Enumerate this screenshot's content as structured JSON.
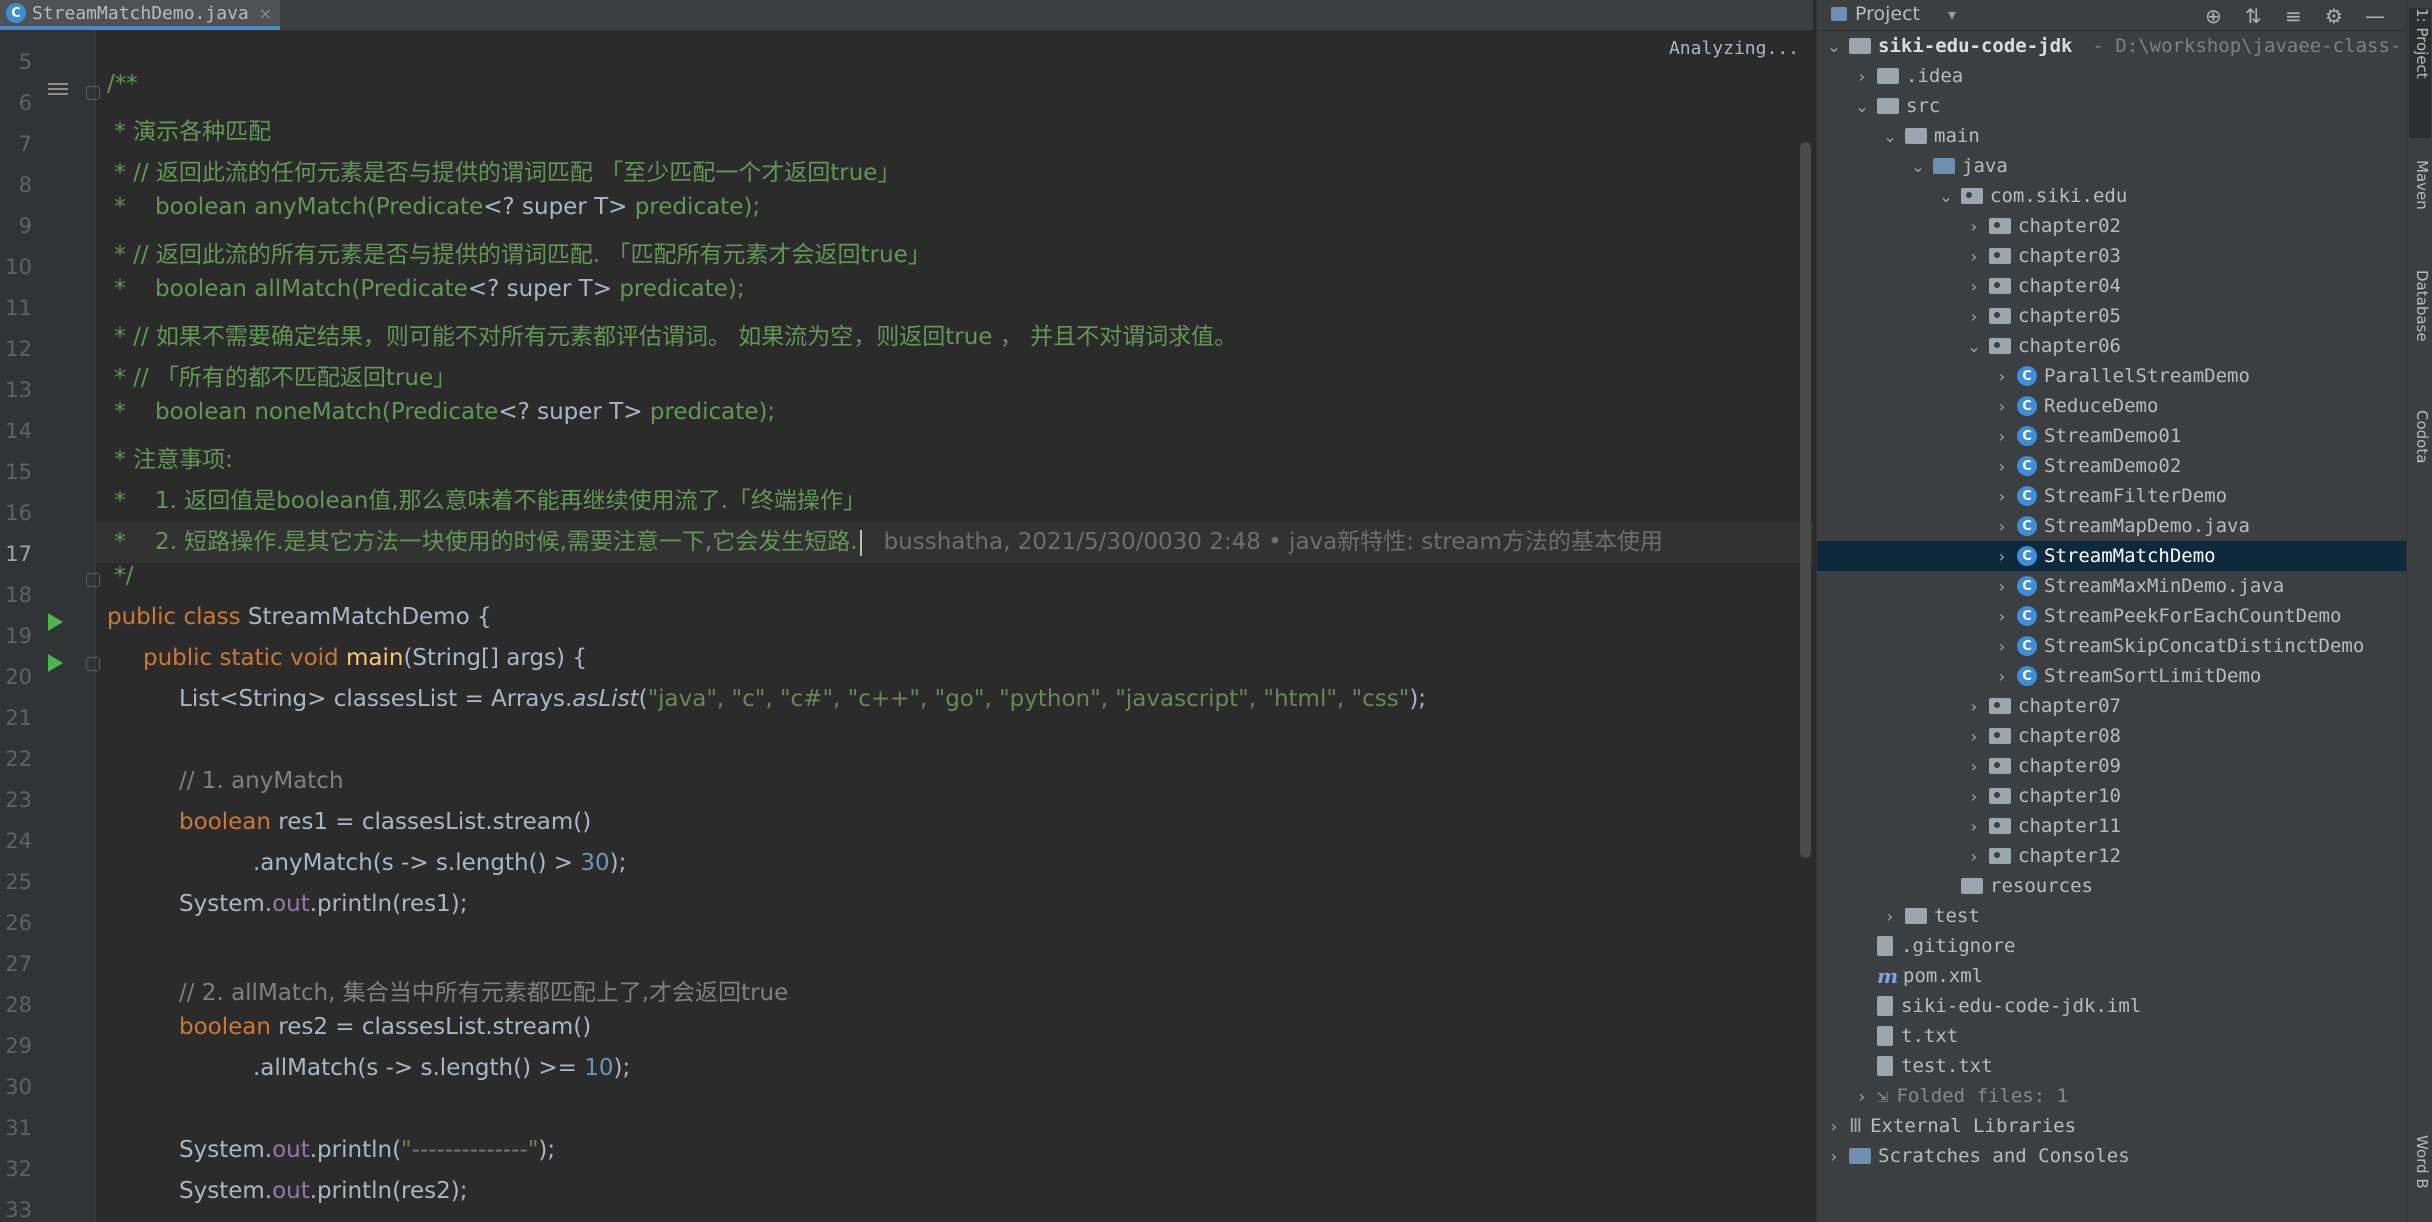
{
  "editor": {
    "tab_label": "StreamMatchDemo.java",
    "tab_icon_letter": "C",
    "close_glyph": "×",
    "status": "Analyzing...",
    "line_numbers": [
      "5",
      "6",
      "7",
      "8",
      "9",
      "10",
      "11",
      "12",
      "13",
      "14",
      "15",
      "16",
      "17",
      "18",
      "19",
      "20",
      "21",
      "22",
      "23",
      "24",
      "25",
      "26",
      "27",
      "28",
      "29",
      "30",
      "31",
      "32",
      "33"
    ],
    "lines": {
      "l6": "/**",
      "l7": " * 演示各种匹配",
      "l8": " * // 返回此流的任何元素是否与提供的谓词匹配 「至少匹配一个才返回true」",
      "l9_a": " *    boolean anyMatch(Predicate",
      "l9_b": "<? super T>",
      "l9_c": " predicate);",
      "l10": " * // 返回此流的所有元素是否与提供的谓词匹配. 「匹配所有元素才会返回true」",
      "l11_a": " *    boolean allMatch(Predicate",
      "l11_b": "<? super T>",
      "l11_c": " predicate);",
      "l12": " * // 如果不需要确定结果，则可能不对所有元素都评估谓词。 如果流为空，则返回true ， 并且不对谓词求值。",
      "l13": " * // 「所有的都不匹配返回true」",
      "l14_a": " *    boolean noneMatch(Predicate",
      "l14_b": "<? super T>",
      "l14_c": " predicate);",
      "l15": " * 注意事项:",
      "l16": " *    1. 返回值是boolean值,那么意味着不能再继续使用流了.「终端操作」",
      "l17": " *    2. 短路操作.是其它方法一块使用的时候,需要注意一下,它会发生短路.",
      "l17_blame": "busshatha, 2021/5/30/0030 2:48 • java新特性: stream方法的基本使用",
      "l18": " */",
      "l19_kw": "public class",
      "l19_name": " StreamMatchDemo {",
      "l20_kw": "public static void",
      "l20_fn": " main",
      "l20_rest": "(String[] args) {",
      "l21_a": "List<String> classesList = Arrays.",
      "l21_fn": "asList",
      "l21_open": "(",
      "l21_args": "\"java\", \"c\", \"c#\", \"c++\", \"go\", \"python\", \"javascript\", \"html\", \"css\"",
      "l21_close": ");",
      "l23": "// 1. anyMatch",
      "l24_kw": "boolean",
      "l24_rest": " res1 = classesList.stream()",
      "l25_a": ".anyMatch(s -> s.length() > ",
      "l25_num": "30",
      "l25_b": ");",
      "l26_a": "System.",
      "l26_fld": "out",
      "l26_b": ".println(res1);",
      "l28": "// 2. allMatch, 集合当中所有元素都匹配上了,才会返回true",
      "l29_kw": "boolean",
      "l29_rest": " res2 = classesList.stream()",
      "l30_a": ".allMatch(s -> s.length() >= ",
      "l30_num": "10",
      "l30_b": ");",
      "l32_a": "System.",
      "l32_fld": "out",
      "l32_b": ".println(",
      "l32_str": "\"--------------\"",
      "l32_c": ");",
      "l33_a": "System.",
      "l33_fld": "out",
      "l33_b": ".println(res2);"
    }
  },
  "project": {
    "title": "Project",
    "dropdown_glyph": "▾",
    "toolbar": {
      "locate": "⊕",
      "expand": "⇅",
      "collapse": "≡",
      "settings": "⚙",
      "minimize": "—"
    },
    "root_name": "siki-edu-code-jdk",
    "root_path": "- D:\\workshop\\javaee-class-",
    "tree": {
      "idea": ".idea",
      "src": "src",
      "main": "main",
      "java": "java",
      "pkg": "com.siki.edu",
      "chapters_before": [
        "chapter02",
        "chapter03",
        "chapter04",
        "chapter05",
        "chapter06"
      ],
      "files": [
        "ParallelStreamDemo",
        "ReduceDemo",
        "StreamDemo01",
        "StreamDemo02",
        "StreamFilterDemo",
        "StreamMapDemo.java",
        "StreamMatchDemo",
        "StreamMaxMinDemo.java",
        "StreamPeekForEachCountDemo",
        "StreamSkipConcatDistinctDemo",
        "StreamSortLimitDemo"
      ],
      "chapters_after": [
        "chapter07",
        "chapter08",
        "chapter09",
        "chapter10",
        "chapter11",
        "chapter12"
      ],
      "resources": "resources",
      "test": "test",
      "gitignore": ".gitignore",
      "pom": "pom.xml",
      "iml": "siki-edu-code-jdk.iml",
      "t": "t.txt",
      "testtxt": "test.txt",
      "folded": "Folded files: 1",
      "external": "External Libraries",
      "scratches": "Scratches and Consoles"
    }
  },
  "right_strip": {
    "project_tab": "1: Project",
    "maven_tab": "Maven",
    "database_tab": "Database",
    "codota_tab": "Codota",
    "word_tab": "Word B"
  }
}
